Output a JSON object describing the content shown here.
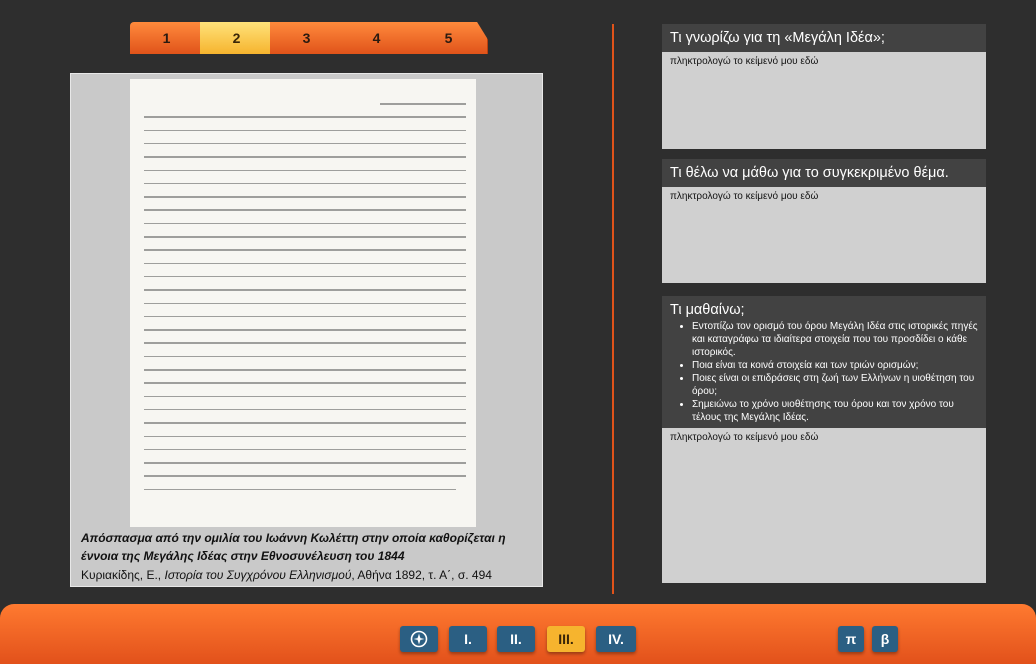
{
  "tabs": [
    "1",
    "2",
    "3",
    "4",
    "5"
  ],
  "active_tab": "2",
  "document": {
    "caption": "Απόσπασμα από την ομιλία του Ιωάννη Κωλέττη στην οποία καθορίζεται η έννοια της Μεγάλης Ιδέας στην Εθνοσυνέλευση του 1844",
    "source_prefix": "Κυριακίδης, Ε., ",
    "source_title": "Ιστορία του Συγχρόνου Ελληνισμού",
    "source_suffix": ", Αθήνα 1892, τ. Α΄, σ. 494"
  },
  "boxes": {
    "know": {
      "title": "Τι γνωρίζω για τη «Μεγάλη Ιδέα»;",
      "placeholder": "πληκτρολογώ το κείμενό μου εδώ"
    },
    "want": {
      "title": "Τι  θέλω να μάθω για το συγκεκριμένο θέμα.",
      "placeholder": "πληκτρολογώ το κείμενό μου εδώ"
    },
    "learn": {
      "title": "Τι μαθαίνω;",
      "bullets": [
        "Εντοπίζω τον ορισμό του όρου Μεγάλη Ιδέα στις ιστορικές πηγές και καταγράφω τα ιδιαίτερα στοιχεία που του προσδίδει ο κάθε ιστορικός.",
        "Ποια είναι τα κοινά στοιχεία και των τριών ορισμών;",
        "Ποιες είναι οι επιδράσεις στη ζωή των Ελλήνων η υιοθέτηση του όρου;",
        "Σημειώνω το χρόνο υιοθέτησης του όρου και τον χρόνο του τέλους της Μεγάλης Ιδέας."
      ],
      "placeholder": "πληκτρολογώ το κείμενό μου εδώ"
    }
  },
  "nav": {
    "compass_icon": "compass-icon",
    "sections": [
      "I.",
      "II.",
      "III.",
      "IV."
    ],
    "active_section": "III.",
    "prev_label": "π",
    "next_label": "β"
  },
  "colors": {
    "accent": "#e2511b",
    "active": "#f6b42e",
    "button": "#2b5f83"
  }
}
